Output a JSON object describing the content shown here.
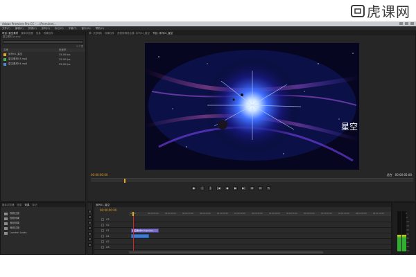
{
  "app": {
    "title": "Adobe Premiere Pro CC - ...\\Premiere\\...",
    "menu": [
      "文件(F)",
      "编辑(E)",
      "剪辑(C)",
      "序列(S)",
      "标记(M)",
      "字幕(T)",
      "窗口(W)",
      "帮助(H)"
    ]
  },
  "watermark": {
    "text": "虎课网"
  },
  "project_panel": {
    "tabs": [
      "项目: 星空素材",
      "媒体浏览器",
      "信息",
      "效果控件"
    ],
    "path": "星空素材.prproj",
    "item_count": "3 个项",
    "headers": [
      "名称",
      "帧速率"
    ],
    "items": [
      {
        "name": "序列01_星空",
        "rate": "25.00 fps",
        "color": "#e8a818"
      },
      {
        "name": "星空素材03.mp4",
        "rate": "25.00 fps",
        "color": "#4cb050"
      },
      {
        "name": "星空素材04.mp4",
        "rate": "25.00 fps",
        "color": "#4a8ad8"
      }
    ]
  },
  "program_monitor": {
    "tabs": [
      "源: (无剪辑)",
      "效果控件",
      "音频剪辑混合器: 序列01_星空",
      "节目: 序列01_星空"
    ],
    "timecode_current": "00:00:00:00",
    "timecode_total": "00:00:05:00",
    "zoom": "适合",
    "transport": [
      "◆",
      "{",
      "}",
      "|◀",
      "◀",
      "▶",
      "▶|",
      "⊞",
      "⊡",
      "✎"
    ],
    "video_caption": "星空"
  },
  "media_browser": {
    "tabs": [
      "媒体浏览器",
      "信息",
      "效果",
      "标记"
    ],
    "folders": [
      "视频过渡",
      "视频效果",
      "音频效果",
      "音频过渡",
      "Lumetri Looks"
    ]
  },
  "timeline": {
    "tab": "序列01_星空",
    "timecode": "00:00:00:00",
    "ruler": [
      "00:00",
      "00:00:05:00",
      "00:00:10:00",
      "00:00:15:00",
      "00:00:20:00",
      "00:00:25:00",
      "00:00:30:00",
      "00:00:35:00",
      "00:00:40:00",
      "00:00:45:00",
      "00:00:50:00",
      "00:00:55:00",
      "00:01:00:00",
      "00:01:05:00",
      "00:01:10:00"
    ],
    "tracks": [
      "V3",
      "V2",
      "V1",
      "A1",
      "A2",
      "A3"
    ],
    "video_clip_label": "星空素材03.mp4 [V]"
  },
  "audio_meter": {
    "scale": [
      "0",
      "-6",
      "-12",
      "-18",
      "-24",
      "-30",
      "-36",
      "-42",
      "-48",
      "-54"
    ],
    "level_left": 0.42,
    "level_right": 0.42
  }
}
